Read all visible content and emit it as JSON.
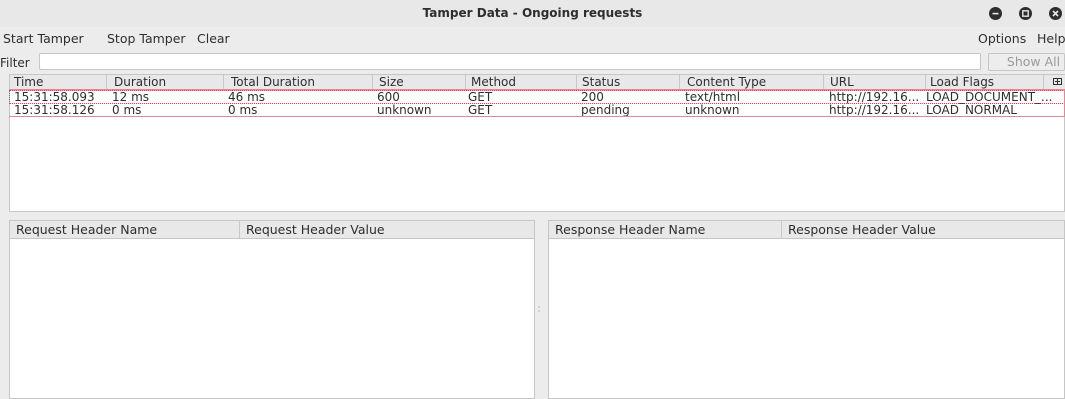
{
  "window": {
    "title": "Tamper Data - Ongoing requests"
  },
  "menu": {
    "start_tamper": "Start Tamper",
    "stop_tamper": "Stop Tamper",
    "clear": "Clear",
    "options": "Options",
    "help": "Help"
  },
  "filter": {
    "label": "Filter",
    "value": "",
    "show_all": "Show All"
  },
  "requests": {
    "columns": [
      "Time",
      "Duration",
      "Total Duration",
      "Size",
      "Method",
      "Status",
      "Content Type",
      "URL",
      "Load Flags"
    ],
    "rows": [
      [
        "15:31:58.093",
        "12 ms",
        "46 ms",
        "600",
        "GET",
        "200",
        "text/html",
        "http://192.16...",
        "LOAD_DOCUMENT_..."
      ],
      [
        "15:31:58.126",
        "0 ms",
        "0 ms",
        "unknown",
        "GET",
        "pending",
        "unknown",
        "http://192.16...",
        "LOAD_NORMAL"
      ]
    ]
  },
  "request_headers": {
    "name_col": "Request Header Name",
    "value_col": "Request Header Value"
  },
  "response_headers": {
    "name_col": "Response Header Name",
    "value_col": "Response Header Value"
  },
  "colors": {
    "selection_outline": "#d04a5a",
    "window_bg": "#ececec",
    "button_dark": "#2e2e2e"
  }
}
